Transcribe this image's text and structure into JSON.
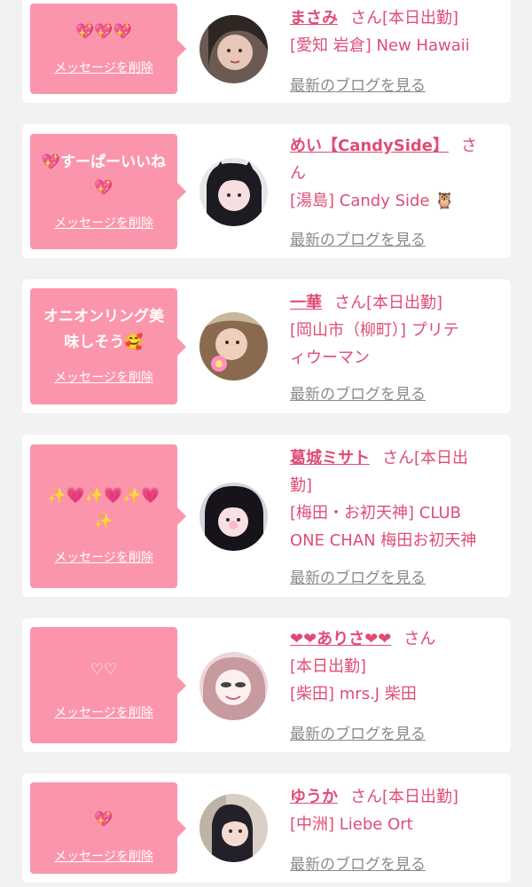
{
  "common": {
    "delete_label": "メッセージを削除",
    "blog_label": "最新のブログを見る"
  },
  "cards": [
    {
      "message": "💖💖💖",
      "name": "まさみ",
      "suffix": "さん[本日出勤]",
      "shop": "[愛知 岩倉] New Hawaii"
    },
    {
      "message_line1": "💖すーぱーいいね",
      "message_line2": "💖",
      "name": "めい【CandySide】",
      "suffix": "さ",
      "suffix2": "ん",
      "shop": "[湯島] Candy Side 🦉"
    },
    {
      "message_line1": "オニオンリング美",
      "message_line2": "味しそう🥰",
      "name": "一華",
      "suffix": "さん[本日出勤]",
      "shop_line1": "[岡山市（柳町）] プリテ",
      "shop_line2": "ィウーマン"
    },
    {
      "message_line1": "✨💗✨💗✨💗",
      "message_line2": "✨",
      "name": "葛城ミサト",
      "suffix": "さん[本日出",
      "suffix2": "勤]",
      "shop_line1": "[梅田・お初天神] CLUB",
      "shop_line2": "ONE CHAN 梅田お初天神"
    },
    {
      "message": "♡♡",
      "name": "❤❤ありさ❤❤",
      "suffix": "さん",
      "suffix2": "[本日出勤]",
      "shop": "[柴田] mrs.J 柴田"
    },
    {
      "message": "💖",
      "name": "ゆうか",
      "suffix": "さん[本日出勤]",
      "shop": "[中洲] Liebe Ort"
    }
  ],
  "colors": {
    "bubble": "#fb95ac",
    "accent": "#e04c75",
    "link_gray": "#8a8a8a",
    "background": "#f2f2f2"
  }
}
